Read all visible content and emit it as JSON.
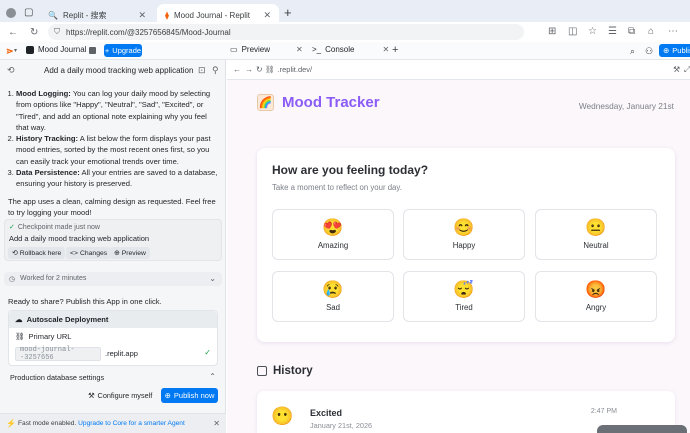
{
  "browser": {
    "tabs": [
      {
        "label": "Replit - 搜索",
        "active": false
      },
      {
        "label": "Mood Journal - Replit",
        "active": true
      }
    ],
    "new_tab": "+",
    "url": "https://replit.com/@3257656845/Mood-Journal"
  },
  "replit": {
    "project_name": "Mood Journal",
    "upgrade_label": "Upgrade",
    "pane_tabs": [
      {
        "label": "Preview"
      },
      {
        "label": "Console"
      }
    ],
    "publish_label": "Publish"
  },
  "agent": {
    "header_title": "Add a daily mood tracking web application",
    "message": {
      "items": [
        {
          "title": "Mood Logging:",
          "text": "You can log your daily mood by selecting from options like \"Happy\", \"Neutral\", \"Sad\", \"Excited\", or \"Tired\", and add an optional note explaining why you feel that way."
        },
        {
          "title": "History Tracking:",
          "text": "A list below the form displays your past mood entries, sorted by the most recent ones first, so you can easily track your emotional trends over time."
        },
        {
          "title": "Data Persistence:",
          "text": "All your entries are saved to a database, ensuring your history is preserved."
        }
      ],
      "closing": "The app uses a clean, calming design as requested. Feel free to try logging your mood!"
    },
    "checkpoint": {
      "status": "Checkpoint made just now",
      "description": "Add a daily mood tracking web application",
      "buttons": [
        "Rollback here",
        "Changes",
        "Preview"
      ]
    },
    "worked": "Worked for 2 minutes",
    "ready_text": "Ready to share? Publish this App in one click.",
    "deployment": {
      "title": "Autoscale Deployment",
      "primary_url_label": "Primary URL",
      "subdomain_value": "mood-journal--3257656",
      "domain_suffix": ".replit.app"
    },
    "production_db": "Production database settings",
    "configure_label": "Configure myself",
    "publish_now_label": "Publish now",
    "fast_mode": {
      "text": "Fast mode enabled.",
      "link": "Upgrade to Core for a smarter Agent"
    }
  },
  "preview": {
    "url": ".replit.dev/",
    "app_title": "Mood Tracker",
    "date": "Wednesday, January 21st",
    "question": "How are you feeling today?",
    "subtitle": "Take a moment to reflect on your day.",
    "moods": [
      {
        "label": "Amazing",
        "emoji": "😍"
      },
      {
        "label": "Happy",
        "emoji": "😊"
      },
      {
        "label": "Neutral",
        "emoji": "😐"
      },
      {
        "label": "Sad",
        "emoji": "😢"
      },
      {
        "label": "Tired",
        "emoji": "😴"
      },
      {
        "label": "Angry",
        "emoji": "😡"
      }
    ],
    "history_title": "History",
    "entries": [
      {
        "mood": "Excited",
        "emoji": "😶",
        "date": "January 21st, 2026",
        "time": "2:47 PM"
      }
    ]
  },
  "colors": {
    "accent": "#0079f2",
    "app_title": "#8b5cf6",
    "preview_bg": "#fbf7fb"
  }
}
